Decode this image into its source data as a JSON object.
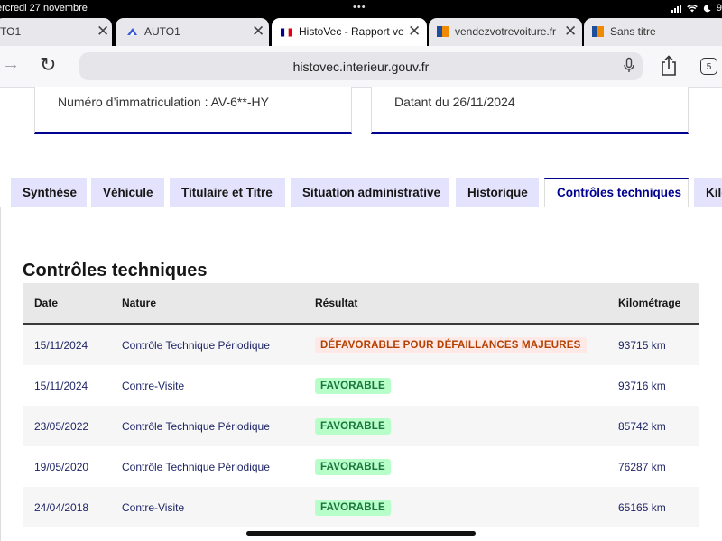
{
  "status_bar": {
    "time": "ercredi 27 novembre",
    "dots": "•••",
    "battery_fragment": "9"
  },
  "browser_tabs": [
    {
      "label": "TO1",
      "favicon": "generic-favicon",
      "close": "✕"
    },
    {
      "label": "AUTO1",
      "favicon": "auto1-favicon",
      "close": "✕"
    },
    {
      "label": "HistoVec - Rapport ve",
      "favicon": "french-flag-favicon",
      "close": "✕",
      "active": true
    },
    {
      "label": "vendezvotrevoiture.fr",
      "favicon": "orange-blue-favicon",
      "close": "✕"
    },
    {
      "label": "Sans titre",
      "favicon": "orange-blue-favicon"
    }
  ],
  "toolbar": {
    "url": "histovec.interieur.gouv.fr",
    "tabs_count": "5"
  },
  "cards": [
    {
      "text": "Numéro d’immatriculation : AV-6**-HY"
    },
    {
      "text": "Datant du 26/11/2024"
    }
  ],
  "nav_tabs": [
    {
      "label": "Synthèse"
    },
    {
      "label": "Véhicule"
    },
    {
      "label": "Titulaire et Titre"
    },
    {
      "label": "Situation administrative"
    },
    {
      "label": "Historique"
    },
    {
      "label": "Contrôles techniques",
      "active": true
    },
    {
      "label": "Kilo"
    }
  ],
  "section": {
    "title": "Contrôles techniques"
  },
  "table": {
    "headers": [
      "Date",
      "Nature",
      "Résultat",
      "Kilométrage"
    ],
    "rows": [
      {
        "date": "15/11/2024",
        "nature": "Contrôle Technique Périodique",
        "result": "DÉFAVORABLE POUR DÉFAILLANCES MAJEURES",
        "result_status": "unfavorable",
        "mileage": "93715 km"
      },
      {
        "date": "15/11/2024",
        "nature": "Contre-Visite",
        "result": "FAVORABLE",
        "result_status": "favorable",
        "mileage": "93716 km"
      },
      {
        "date": "23/05/2022",
        "nature": "Contrôle Technique Périodique",
        "result": "FAVORABLE",
        "result_status": "favorable",
        "mileage": "85742 km"
      },
      {
        "date": "19/05/2020",
        "nature": "Contrôle Technique Périodique",
        "result": "FAVORABLE",
        "result_status": "favorable",
        "mileage": "76287 km"
      },
      {
        "date": "24/04/2018",
        "nature": "Contre-Visite",
        "result": "FAVORABLE",
        "result_status": "favorable",
        "mileage": "65165 km"
      }
    ]
  },
  "colors": {
    "accent_blue": "#000091",
    "tab_inactive": "#e3e3fd",
    "badge_red_bg": "#ffe9e6",
    "badge_red_text": "#b34000",
    "badge_green_bg": "#b8fec9",
    "badge_green_text": "#18753c"
  }
}
